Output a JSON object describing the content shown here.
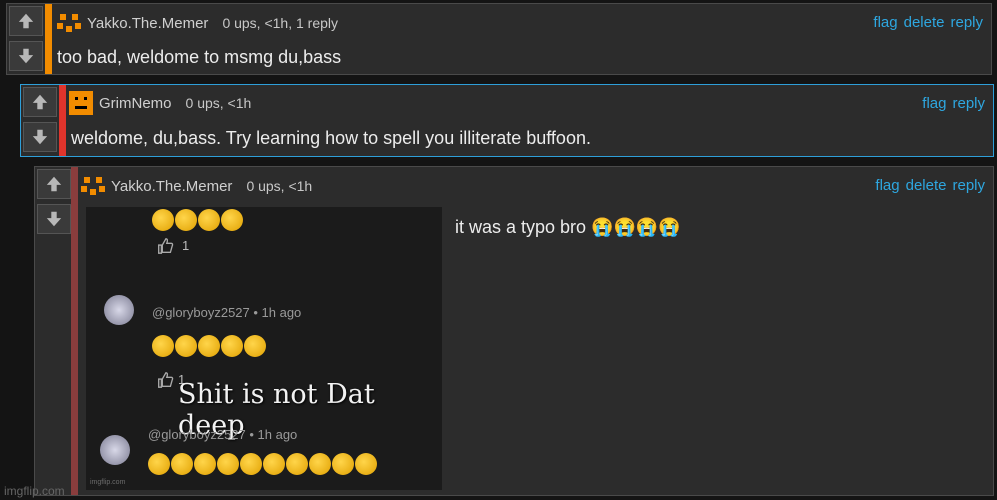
{
  "comments": [
    {
      "user": "Yakko.The.Memer",
      "meta": "0 ups, <1h, 1 reply",
      "text": "too bad, weldome to msmg du,bass",
      "actions": [
        "flag",
        "delete",
        "reply"
      ],
      "accent": "#f28c00"
    },
    {
      "user": "GrimNemo",
      "meta": "0 ups, <1h",
      "text": "weldome, du,bass. Try learning how to spell you illiterate buffoon.",
      "actions": [
        "flag",
        "reply"
      ],
      "accent": "#e0342c"
    },
    {
      "user": "Yakko.The.Memer",
      "meta": "0 ups, <1h",
      "text": "it was a typo bro 😭😭😭😭",
      "actions": [
        "flag",
        "delete",
        "reply"
      ],
      "accent": "#8a3d3d"
    }
  ],
  "meme": {
    "caption": "Shit is not Dat deep",
    "users": [
      "@gloryboyz2527 • 1h ago",
      "@gloryboyz2527 • 1h ago"
    ],
    "like_count": "1",
    "like_count_2": "1",
    "watermark": "imgflip.com"
  },
  "site_watermark": "imgflip.com",
  "colors": {
    "link": "#2ea7e0",
    "background": "#2c2c2c"
  }
}
